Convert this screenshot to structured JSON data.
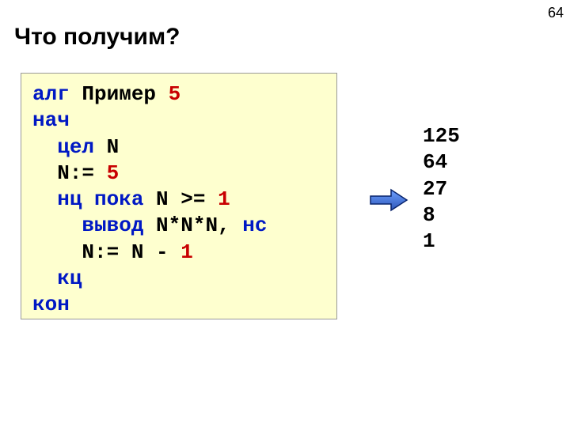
{
  "page_number": "64",
  "title": "Что получим?",
  "code": {
    "l1_kw": "алг",
    "l1_rest": " Пример ",
    "l1_num": "5",
    "l2_kw": "нач",
    "l3_pad": "  ",
    "l3_kw": "цел",
    "l3_rest": " N",
    "l4_pad": "  N:= ",
    "l4_num": "5",
    "l5_pad": "  ",
    "l5_kw": "нц пока",
    "l5_mid": " N >= ",
    "l5_num": "1",
    "l6_pad": "    ",
    "l6_kw": "вывод",
    "l6_mid": " N*N*N, ",
    "l6_kw2": "нс",
    "l7_pad": "    N:= N - ",
    "l7_num": "1",
    "l8_pad": "  ",
    "l8_kw": "кц",
    "l9_kw": "кон"
  },
  "output_lines": [
    "125",
    "64",
    "27",
    "8",
    "1"
  ],
  "arrow_color_fill": "#3366cc",
  "arrow_color_stroke": "#001a66"
}
